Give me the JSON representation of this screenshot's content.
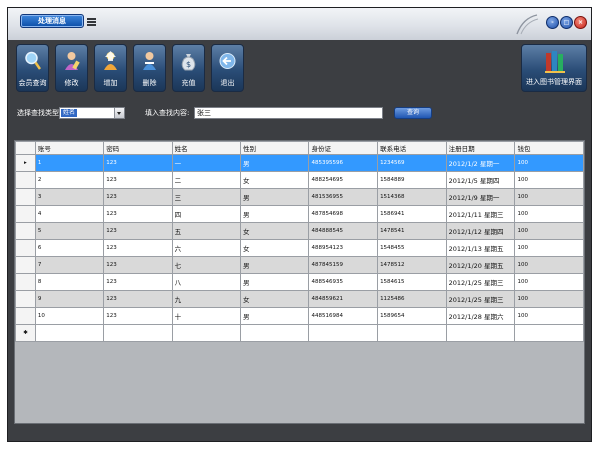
{
  "window": {
    "title": "处理消息",
    "controls": {
      "minimize": "-",
      "maximize": "□",
      "close": "×"
    }
  },
  "toolbar": {
    "buttons": [
      {
        "label": "会员查询",
        "icon": "magnifier-icon"
      },
      {
        "label": "修改",
        "icon": "edit-user-icon"
      },
      {
        "label": "增加",
        "icon": "add-user-icon"
      },
      {
        "label": "删除",
        "icon": "delete-user-icon"
      },
      {
        "label": "充值",
        "icon": "money-bag-icon"
      },
      {
        "label": "退出",
        "icon": "exit-arrow-icon"
      }
    ],
    "right_button": {
      "label": "进入图书管理界面",
      "icon": "books-icon"
    }
  },
  "search": {
    "type_label": "选择查找类型:",
    "type_value": "姓名",
    "content_label": "填入查找内容:",
    "content_value": "张三",
    "query_button": "查询"
  },
  "grid": {
    "columns": [
      "账号",
      "密码",
      "姓名",
      "性别",
      "身份证",
      "联系电话",
      "注册日期",
      "钱包"
    ],
    "selected_row": 0,
    "rows": [
      [
        "1",
        "123",
        "一",
        "男",
        "485395596",
        "1234569",
        "2012/1/2 星期一",
        "100"
      ],
      [
        "2",
        "123",
        "二",
        "女",
        "488254695",
        "1584889",
        "2012/1/5 星期四",
        "100"
      ],
      [
        "3",
        "123",
        "三",
        "男",
        "481536955",
        "1514368",
        "2012/1/9 星期一",
        "100"
      ],
      [
        "4",
        "123",
        "四",
        "男",
        "487854698",
        "1586941",
        "2012/1/11 星期三",
        "100"
      ],
      [
        "5",
        "123",
        "五",
        "女",
        "484888545",
        "1478541",
        "2012/1/12 星期四",
        "100"
      ],
      [
        "6",
        "123",
        "六",
        "女",
        "488954123",
        "1548455",
        "2012/1/13 星期五",
        "100"
      ],
      [
        "7",
        "123",
        "七",
        "男",
        "487845159",
        "1478512",
        "2012/1/20 星期五",
        "100"
      ],
      [
        "8",
        "123",
        "八",
        "男",
        "488546935",
        "1584615",
        "2012/1/25 星期三",
        "100"
      ],
      [
        "9",
        "123",
        "九",
        "女",
        "484859621",
        "1125486",
        "2012/1/25 星期三",
        "100"
      ],
      [
        "10",
        "123",
        "十",
        "男",
        "448516984",
        "1589654",
        "2012/1/28 星期六",
        "100"
      ]
    ],
    "current_marker": "▸",
    "new_row_marker": "✱"
  }
}
